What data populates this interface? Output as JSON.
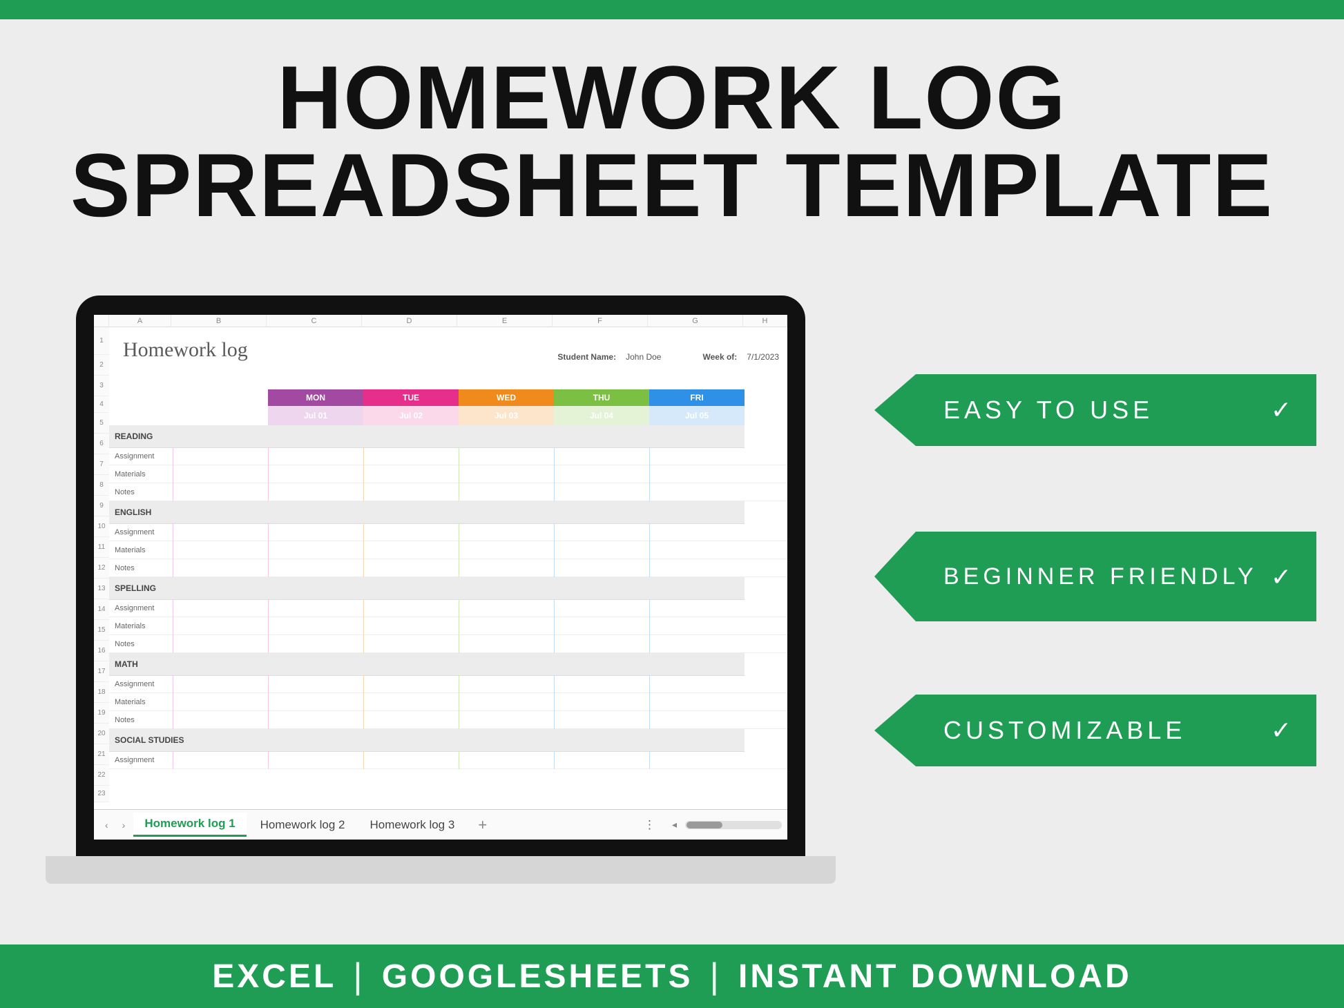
{
  "hero": {
    "line1": "HOMEWORK LOG",
    "line2": "SPREADSHEET TEMPLATE"
  },
  "callouts": {
    "easy": "EASY TO USE",
    "beginner": "BEGINNER FRIENDLY",
    "custom": "CUSTOMIZABLE",
    "check": "✓"
  },
  "footer": {
    "excel": "EXCEL",
    "gsheets": "GOOGLESHEETS",
    "instant": "INSTANT DOWNLOAD"
  },
  "sheet": {
    "title": "Homework log",
    "student_label": "Student Name:",
    "student_name": "John Doe",
    "week_label": "Week of:",
    "week_value": "7/1/2023",
    "columns": [
      "A",
      "B",
      "C",
      "D",
      "E",
      "F",
      "G",
      "H"
    ],
    "days": {
      "mon": {
        "label": "MON",
        "date": "Jul 01"
      },
      "tue": {
        "label": "TUE",
        "date": "Jul 02"
      },
      "wed": {
        "label": "WED",
        "date": "Jul 03"
      },
      "thu": {
        "label": "THU",
        "date": "Jul 04"
      },
      "fri": {
        "label": "FRI",
        "date": "Jul 05"
      }
    },
    "subjects": [
      "READING",
      "ENGLISH",
      "SPELLING",
      "MATH",
      "SOCIAL STUDIES"
    ],
    "subrows": [
      "Assignment",
      "Materials",
      "Notes"
    ],
    "tabs": {
      "t1": "Homework log 1",
      "t2": "Homework log 2",
      "t3": "Homework log 3",
      "add": "+",
      "more": "⋮",
      "prev": "‹",
      "next": "›",
      "scroll_left": "◂"
    }
  }
}
